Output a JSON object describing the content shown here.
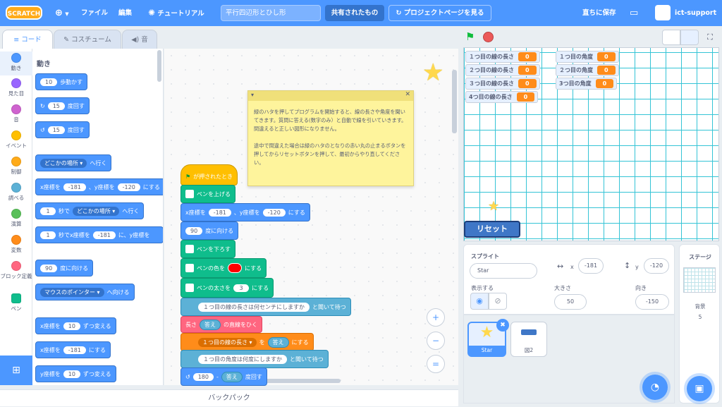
{
  "topbar": {
    "logo": "SCRATCH",
    "file_menu": "ファイル",
    "edit_menu": "編集",
    "tutorial": "チュートリアル",
    "project_title": "平行四辺形とひし形",
    "share": "共有されたもの",
    "project_page": "プロジェクトページを見る",
    "save_now": "直ちに保存",
    "username": "ict-support"
  },
  "tabs": {
    "code": "コード",
    "costume": "コスチューム",
    "sound": "音"
  },
  "categories": [
    {
      "label": "動き",
      "color": "#4c97ff"
    },
    {
      "label": "見た目",
      "color": "#9966ff"
    },
    {
      "label": "音",
      "color": "#cf63cf"
    },
    {
      "label": "イベント",
      "color": "#ffbf00"
    },
    {
      "label": "制御",
      "color": "#ffab19"
    },
    {
      "label": "調べる",
      "color": "#5cb1d6"
    },
    {
      "label": "演算",
      "color": "#59c059"
    },
    {
      "label": "変数",
      "color": "#ff8c1a"
    },
    {
      "label": "ブロック定義",
      "color": "#ff6680"
    },
    {
      "label": "ペン",
      "color": "#0fbd8c"
    }
  ],
  "palette": {
    "heading": "動き",
    "move_val": "10",
    "move_txt": "歩動かす",
    "turn_r_val": "15",
    "turn_r_txt": "度回す",
    "turn_l_val": "15",
    "turn_l_txt": "度回す",
    "goto_drop": "どこかの場所 ▾",
    "goto_txt": "へ行く",
    "gotoxy_x_lbl": "x座標を",
    "gotoxy_x": "-181",
    "gotoxy_y_lbl": "、y座標を",
    "gotoxy_y": "-120",
    "gotoxy_end": "にする",
    "glide_val": "1",
    "glide_lbl": "秒で",
    "glide_drop": "どこかの場所 ▾",
    "glide_end": "へ行く",
    "glidexy_val": "1",
    "glidexy_lbl": "秒でx座標を",
    "glidexy_x": "-181",
    "glidexy_mid": "に、y座標を",
    "point_val": "90",
    "point_txt": "度に向ける",
    "towards_drop": "マウスのポインター ▾",
    "towards_txt": "へ向ける",
    "changex_lbl": "x座標を",
    "changex_val": "10",
    "changex_txt": "ずつ変える",
    "setx_lbl": "x座標を",
    "setx_val": "-181",
    "setx_txt": "にする",
    "changey_lbl": "y座標を",
    "changey_val": "10",
    "changey_txt": "ずつ変える"
  },
  "script": {
    "hat": "が押されたとき",
    "penup": "ペンを上げる",
    "goto_lbl": "x座標を",
    "goto_x": "-181",
    "goto_mid": "、y座標を",
    "goto_y": "-120",
    "goto_end": "にする",
    "point_val": "90",
    "point_txt": "度に向ける",
    "pendown": "ペンを下ろす",
    "pencolor_lbl": "ペンの色を",
    "pencolor_end": "にする",
    "pen_color": "#ff0000",
    "pensize_lbl": "ペンの太さを",
    "pensize_val": "3",
    "pensize_end": "にする",
    "ask1_q": "１つ目の線の長さは何センチにしますか",
    "ask1_end": "と聞いて待つ",
    "draw_lbl": "長さ",
    "draw_ans": "答え",
    "draw_end": "の直線をひく",
    "setvar_drop": "１つ目の線の長さ ▾",
    "setvar_mid": "を",
    "setvar_val": "答え",
    "setvar_end": "にする",
    "ask2_q": "１つ目の角度は何度にしますか",
    "ask2_end": "と聞いて待つ",
    "turn_val": "180",
    "turn_op": "-",
    "turn_ans": "答え",
    "turn_end": "度回す"
  },
  "note": {
    "text": "緑のハタを押してプログラムを開始すると、線の長さや角度を聞いてきます。質問に答える(数字のみ）と自動で線を引いていきます。間違えると正しい図形になりません。\n\n途中で間違えた場合は緑のハタのとなりの赤い丸の止まるボタンを押してからリセットボタンを押して、最初からやり直してください。"
  },
  "zoom": {
    "in": "+",
    "out": "−",
    "reset": "="
  },
  "backpack": "バックパック",
  "monitors": [
    {
      "label": "１つ目の線の長さ",
      "value": "0"
    },
    {
      "label": "２つ目の線の長さ",
      "value": "0"
    },
    {
      "label": "３つ目の線の長さ",
      "value": "0"
    },
    {
      "label": "4つ目の線の長さ",
      "value": "0"
    },
    {
      "label": "１つ目の角度",
      "value": "0"
    },
    {
      "label": "２つ目の角度",
      "value": "0"
    },
    {
      "label": "3つ目の角度",
      "value": "0"
    }
  ],
  "reset_button": "リセット",
  "sprite_info": {
    "sprite_lbl": "スプライト",
    "sprite_name": "Star",
    "x_lbl": "x",
    "x_val": "-181",
    "y_lbl": "y",
    "y_val": "-120",
    "show_lbl": "表示する",
    "size_lbl": "大きさ",
    "size_val": "50",
    "dir_lbl": "向き",
    "dir_val": "-150"
  },
  "sprites": [
    {
      "name": "Star"
    },
    {
      "name": "図2"
    }
  ],
  "stage_panel": {
    "title": "ステージ",
    "backdrop_lbl": "背景",
    "backdrop_count": "5"
  }
}
